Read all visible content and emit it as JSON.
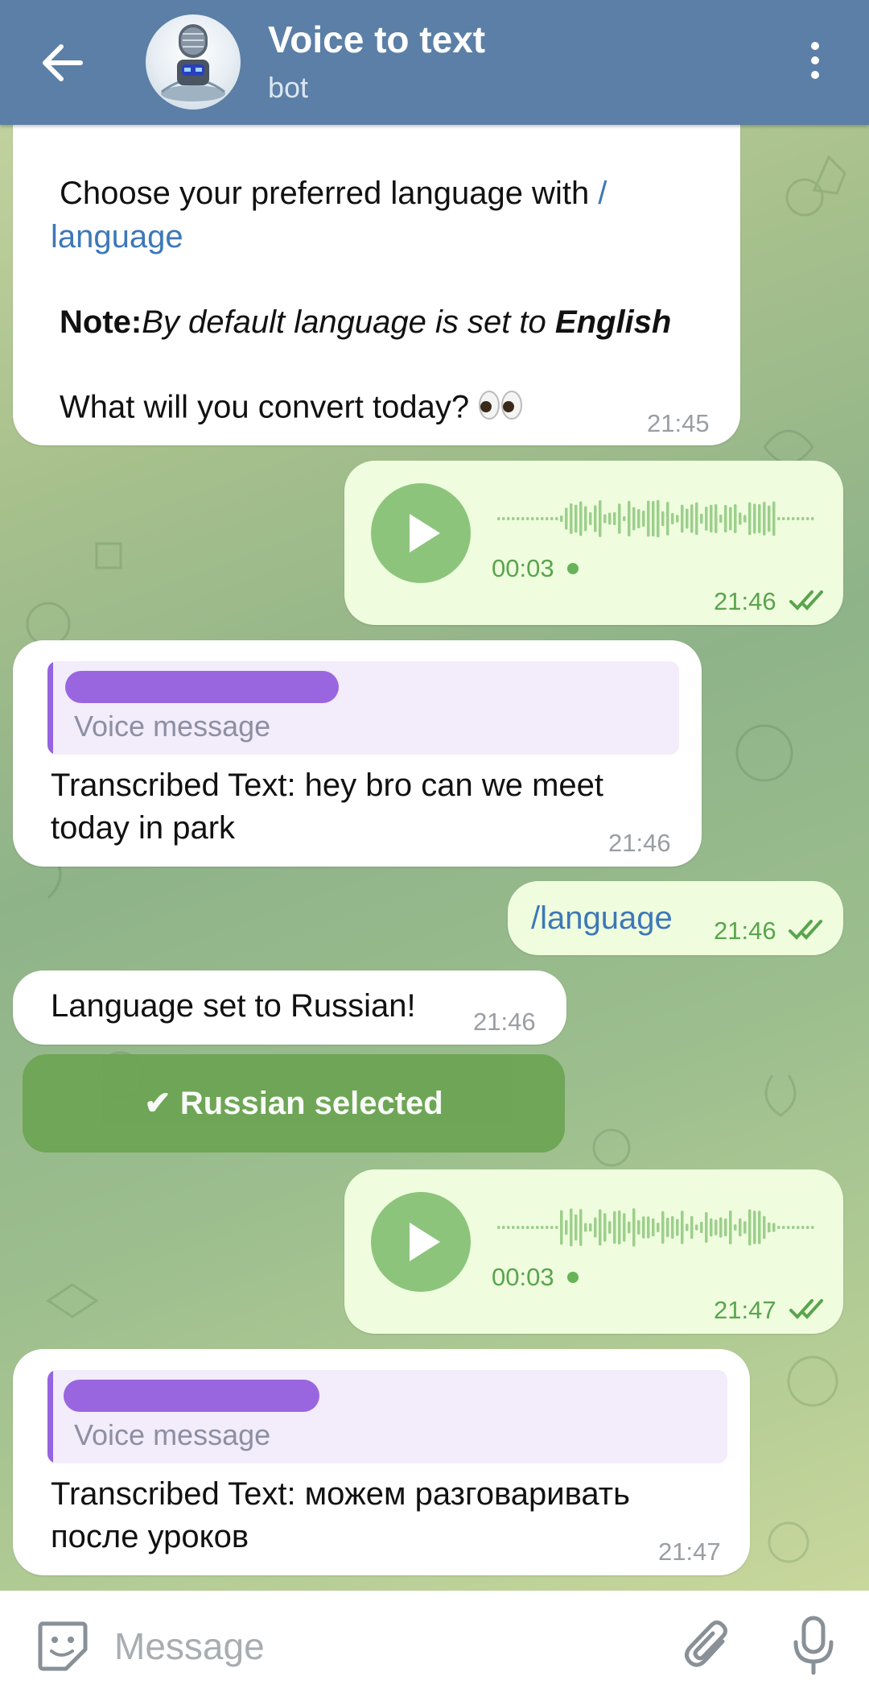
{
  "header": {
    "title": "Voice to text",
    "subtitle": "bot",
    "back_icon": "arrow-left-icon",
    "menu_icon": "more-vertical-icon",
    "color": "#5b7fa6"
  },
  "messages": {
    "welcome": {
      "line1": "Choose your preferred language with ",
      "line1_cmd": "/",
      "line2_cmd": "language",
      "note_label": "Note:",
      "note_text": "By default language is set to ",
      "note_lang": "English",
      "question": "What will you convert today?",
      "time": "21:45"
    },
    "voice1": {
      "duration": "00:03",
      "time": "21:46",
      "status_icon": "double-check-icon"
    },
    "transcript1": {
      "reply_label": "Voice message",
      "line1": "Transcribed Text: hey bro can we meet",
      "line2": "today in park",
      "time": "21:46"
    },
    "command": {
      "text": "/language",
      "time": "21:46",
      "status_icon": "double-check-icon"
    },
    "lang_set": {
      "text": "Language set to Russian!",
      "time": "21:46"
    },
    "inline_button": {
      "label": "✔ Russian selected"
    },
    "voice2": {
      "duration": "00:03",
      "time": "21:47",
      "status_icon": "double-check-icon"
    },
    "transcript2": {
      "reply_label": "Voice message",
      "line1": "Transcribed Text: можем разговаривать",
      "line2": "после уроков",
      "time": "21:47"
    }
  },
  "input": {
    "placeholder": "Message",
    "emoji_icon": "sticker-emoji-icon",
    "attach_icon": "paperclip-icon",
    "mic_icon": "microphone-icon"
  },
  "colors": {
    "incoming": "#ffffff",
    "outgoing": "#effdde",
    "accent_green": "#5aa44e",
    "link": "#3d78b8",
    "reply_name_redaction": "#9a66e0"
  }
}
